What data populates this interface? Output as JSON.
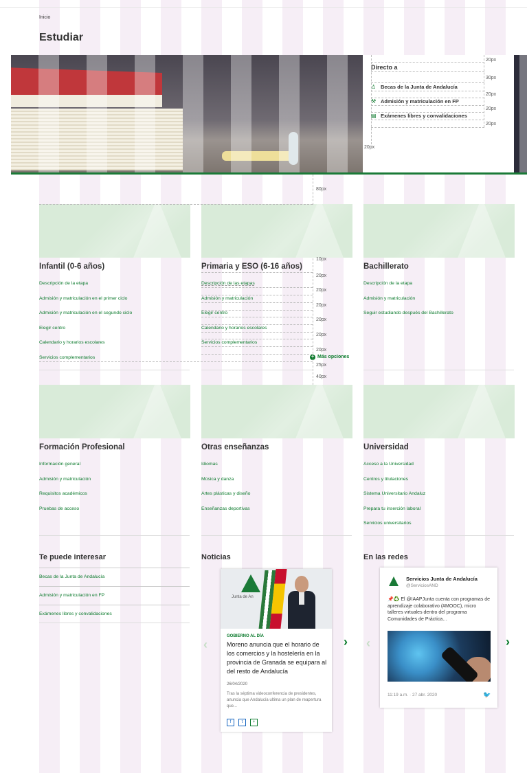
{
  "breadcrumb": "Inicio",
  "title": "Estudiar",
  "directo": {
    "title": "Directo a",
    "items": [
      {
        "icon": "graduation-icon",
        "label": "Becas de la Junta de Andalucía"
      },
      {
        "icon": "tools-icon",
        "label": "Admisión y matriculación en FP"
      },
      {
        "icon": "document-icon",
        "label": "Exámenes libres y convalidaciones"
      }
    ]
  },
  "spacers": {
    "s20": "20px",
    "s30": "30px",
    "s80": "80px",
    "s10": "10px",
    "s25": "25px",
    "s40": "40px"
  },
  "cards": [
    {
      "title": "Infantil (0-6 años)",
      "links": [
        "Descripción de la etapa",
        "Admisión y matriculación en el primer ciclo",
        "Admisión y matriculación en el segundo ciclo",
        "Elegir centro",
        "Calendario y horarios escolares",
        "Servicios complementarios"
      ]
    },
    {
      "title": "Primaria y ESO (6-16 años)",
      "links": [
        "Descripción de las etapas",
        "Admisión y matriculación",
        "Elegir centro",
        "Calendario y horarios escolares",
        "Servicios complementarios"
      ],
      "more": "Más opciones"
    },
    {
      "title": "Bachillerato",
      "links": [
        "Descripción de la etapa",
        "Admisión y matriculación",
        "Seguir estudiando después del Bachillerato"
      ]
    },
    {
      "title": "Formación Profesional",
      "links": [
        "Información general",
        "Admisión y matriculación",
        "Requisitos académicos",
        "Pruebas de acceso"
      ]
    },
    {
      "title": "Otras enseñanzas",
      "links": [
        "Idiomas",
        "Música y danza",
        "Artes plásticas y diseño",
        "Enseñanzas deportivas"
      ]
    },
    {
      "title": "Universidad",
      "links": [
        "Acceso a la Universidad",
        "Centros y titulaciones",
        "Sistema Universitario Andaluz",
        "Prepara tu inserción laboral",
        "Servicios universitarios"
      ]
    }
  ],
  "interesar": {
    "title": "Te puede interesar",
    "items": [
      "Becas de la Junta de Andalucía",
      "Admisión y matriculación en FP",
      "Exámenes libres y convalidaciones"
    ]
  },
  "noticias": {
    "title": "Noticias",
    "image_caption": "Junta de An",
    "category": "GOBIERNO AL DÍA",
    "headline": "Moreno anuncia que el horario de los comercios y la hostelería en la provincia de Granada se equipara al del resto de Andalucía",
    "date": "26/04/2020",
    "body": "Tras la séptima videoconferencia de presidentes, anuncia que Andalucía ultima un plan de reapertura que...",
    "share": [
      "f",
      "t",
      "+"
    ]
  },
  "redes": {
    "title": "En las redes",
    "name": "Servicios Junta de Andalucía",
    "handle": "@ServiciosAND",
    "text": "📌♻️ El @IAAPJunta cuenta con programas de aprendizaje colaborativo (#MOOC), micro talleres virtuales dentro del programa Comunidades de Práctica…",
    "time": "11:19 a.m. · 27 abr. 2020"
  },
  "colors": {
    "accent": "#0b7a2c",
    "guide": "#f6eef6"
  }
}
